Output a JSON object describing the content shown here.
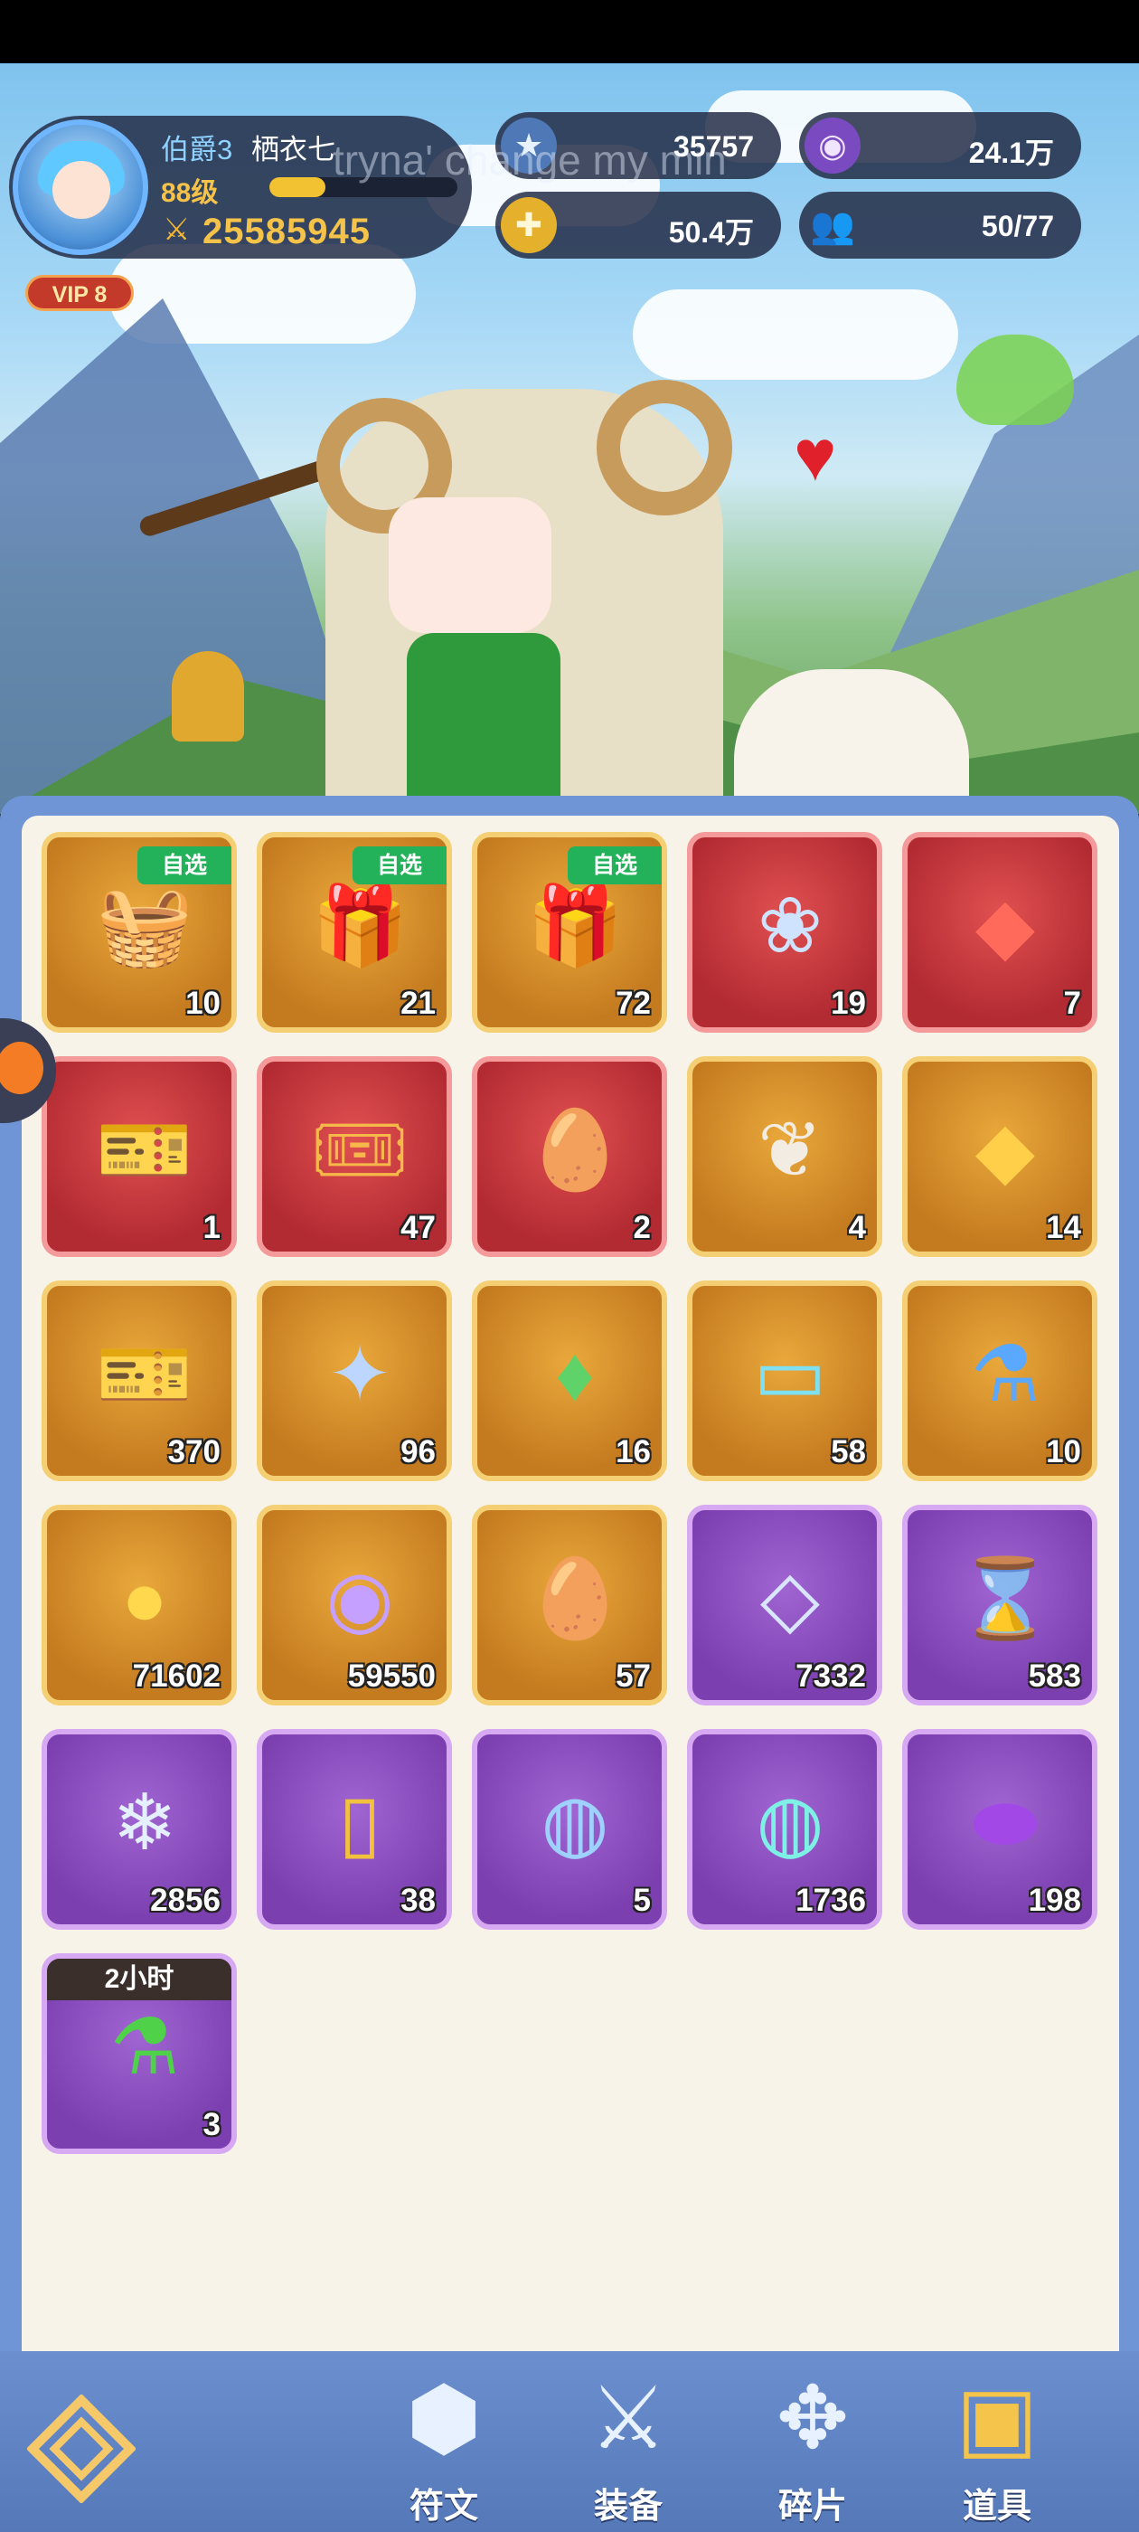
{
  "profile": {
    "rank": "伯爵3",
    "name": "栖衣七",
    "level": "88级",
    "level_progress": 0.3,
    "power": "25585945",
    "vip": "VIP 8"
  },
  "overlay_text": "tryna' change my min",
  "resources": {
    "stars": "35757",
    "purple_currency": "24.1万",
    "gold": "50.4万",
    "heroes": "50/77"
  },
  "inventory": {
    "badge_label": "自选",
    "timer_label": "2小时",
    "items": [
      {
        "count": "10",
        "name": "pet-chest",
        "rarity": "orange",
        "badge": true
      },
      {
        "count": "21",
        "name": "gift-box",
        "rarity": "orange",
        "badge": true
      },
      {
        "count": "72",
        "name": "gift-box",
        "rarity": "orange",
        "badge": true
      },
      {
        "count": "19",
        "name": "lotus-crystal",
        "rarity": "red"
      },
      {
        "count": "7",
        "name": "red-gem",
        "rarity": "red"
      },
      {
        "count": "1",
        "name": "blue-ticket",
        "rarity": "red"
      },
      {
        "count": "47",
        "name": "gold-ticket",
        "rarity": "red"
      },
      {
        "count": "2",
        "name": "fire-egg",
        "rarity": "red"
      },
      {
        "count": "4",
        "name": "coral",
        "rarity": "orange"
      },
      {
        "count": "14",
        "name": "amber-gem",
        "rarity": "orange"
      },
      {
        "count": "370",
        "name": "orange-ticket",
        "rarity": "orange"
      },
      {
        "count": "96",
        "name": "star-crystal",
        "rarity": "orange"
      },
      {
        "count": "16",
        "name": "green-crystal",
        "rarity": "orange"
      },
      {
        "count": "58",
        "name": "teal-card",
        "rarity": "orange"
      },
      {
        "count": "10",
        "name": "potion",
        "rarity": "orange"
      },
      {
        "count": "71602",
        "name": "gold-coin",
        "rarity": "orange"
      },
      {
        "count": "59550",
        "name": "purple-coin",
        "rarity": "orange"
      },
      {
        "count": "57",
        "name": "brown-egg",
        "rarity": "orange"
      },
      {
        "count": "7332",
        "name": "diamond",
        "rarity": "purple"
      },
      {
        "count": "583",
        "name": "hourglass",
        "rarity": "purple"
      },
      {
        "count": "2856",
        "name": "ice-crystal",
        "rarity": "purple"
      },
      {
        "count": "38",
        "name": "gold-card",
        "rarity": "purple"
      },
      {
        "count": "5",
        "name": "crystal-orb",
        "rarity": "purple"
      },
      {
        "count": "1736",
        "name": "teal-orb",
        "rarity": "purple"
      },
      {
        "count": "198",
        "name": "purple-egg",
        "rarity": "purple"
      },
      {
        "count": "3",
        "name": "green-potions",
        "rarity": "purple",
        "timer": true
      }
    ]
  },
  "nav": {
    "rune": "符文",
    "equip": "装备",
    "fragment": "碎片",
    "items": "道具"
  },
  "colors": {
    "tile_orange": "#d48a2a",
    "tile_red": "#c0383c",
    "tile_purple": "#8a4cc0",
    "panel_bg": "#f8f3e8",
    "nav_bg": "#5f82c4"
  }
}
